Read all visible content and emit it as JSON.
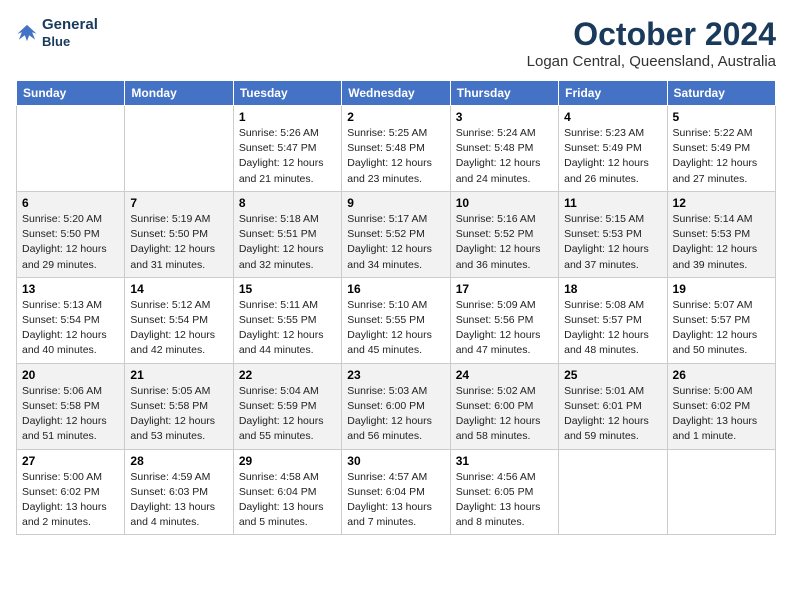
{
  "logo": {
    "line1": "General",
    "line2": "Blue"
  },
  "title": "October 2024",
  "location": "Logan Central, Queensland, Australia",
  "headers": [
    "Sunday",
    "Monday",
    "Tuesday",
    "Wednesday",
    "Thursday",
    "Friday",
    "Saturday"
  ],
  "weeks": [
    [
      {
        "day": "",
        "info": ""
      },
      {
        "day": "",
        "info": ""
      },
      {
        "day": "1",
        "info": "Sunrise: 5:26 AM\nSunset: 5:47 PM\nDaylight: 12 hours\nand 21 minutes."
      },
      {
        "day": "2",
        "info": "Sunrise: 5:25 AM\nSunset: 5:48 PM\nDaylight: 12 hours\nand 23 minutes."
      },
      {
        "day": "3",
        "info": "Sunrise: 5:24 AM\nSunset: 5:48 PM\nDaylight: 12 hours\nand 24 minutes."
      },
      {
        "day": "4",
        "info": "Sunrise: 5:23 AM\nSunset: 5:49 PM\nDaylight: 12 hours\nand 26 minutes."
      },
      {
        "day": "5",
        "info": "Sunrise: 5:22 AM\nSunset: 5:49 PM\nDaylight: 12 hours\nand 27 minutes."
      }
    ],
    [
      {
        "day": "6",
        "info": "Sunrise: 5:20 AM\nSunset: 5:50 PM\nDaylight: 12 hours\nand 29 minutes."
      },
      {
        "day": "7",
        "info": "Sunrise: 5:19 AM\nSunset: 5:50 PM\nDaylight: 12 hours\nand 31 minutes."
      },
      {
        "day": "8",
        "info": "Sunrise: 5:18 AM\nSunset: 5:51 PM\nDaylight: 12 hours\nand 32 minutes."
      },
      {
        "day": "9",
        "info": "Sunrise: 5:17 AM\nSunset: 5:52 PM\nDaylight: 12 hours\nand 34 minutes."
      },
      {
        "day": "10",
        "info": "Sunrise: 5:16 AM\nSunset: 5:52 PM\nDaylight: 12 hours\nand 36 minutes."
      },
      {
        "day": "11",
        "info": "Sunrise: 5:15 AM\nSunset: 5:53 PM\nDaylight: 12 hours\nand 37 minutes."
      },
      {
        "day": "12",
        "info": "Sunrise: 5:14 AM\nSunset: 5:53 PM\nDaylight: 12 hours\nand 39 minutes."
      }
    ],
    [
      {
        "day": "13",
        "info": "Sunrise: 5:13 AM\nSunset: 5:54 PM\nDaylight: 12 hours\nand 40 minutes."
      },
      {
        "day": "14",
        "info": "Sunrise: 5:12 AM\nSunset: 5:54 PM\nDaylight: 12 hours\nand 42 minutes."
      },
      {
        "day": "15",
        "info": "Sunrise: 5:11 AM\nSunset: 5:55 PM\nDaylight: 12 hours\nand 44 minutes."
      },
      {
        "day": "16",
        "info": "Sunrise: 5:10 AM\nSunset: 5:55 PM\nDaylight: 12 hours\nand 45 minutes."
      },
      {
        "day": "17",
        "info": "Sunrise: 5:09 AM\nSunset: 5:56 PM\nDaylight: 12 hours\nand 47 minutes."
      },
      {
        "day": "18",
        "info": "Sunrise: 5:08 AM\nSunset: 5:57 PM\nDaylight: 12 hours\nand 48 minutes."
      },
      {
        "day": "19",
        "info": "Sunrise: 5:07 AM\nSunset: 5:57 PM\nDaylight: 12 hours\nand 50 minutes."
      }
    ],
    [
      {
        "day": "20",
        "info": "Sunrise: 5:06 AM\nSunset: 5:58 PM\nDaylight: 12 hours\nand 51 minutes."
      },
      {
        "day": "21",
        "info": "Sunrise: 5:05 AM\nSunset: 5:58 PM\nDaylight: 12 hours\nand 53 minutes."
      },
      {
        "day": "22",
        "info": "Sunrise: 5:04 AM\nSunset: 5:59 PM\nDaylight: 12 hours\nand 55 minutes."
      },
      {
        "day": "23",
        "info": "Sunrise: 5:03 AM\nSunset: 6:00 PM\nDaylight: 12 hours\nand 56 minutes."
      },
      {
        "day": "24",
        "info": "Sunrise: 5:02 AM\nSunset: 6:00 PM\nDaylight: 12 hours\nand 58 minutes."
      },
      {
        "day": "25",
        "info": "Sunrise: 5:01 AM\nSunset: 6:01 PM\nDaylight: 12 hours\nand 59 minutes."
      },
      {
        "day": "26",
        "info": "Sunrise: 5:00 AM\nSunset: 6:02 PM\nDaylight: 13 hours\nand 1 minute."
      }
    ],
    [
      {
        "day": "27",
        "info": "Sunrise: 5:00 AM\nSunset: 6:02 PM\nDaylight: 13 hours\nand 2 minutes."
      },
      {
        "day": "28",
        "info": "Sunrise: 4:59 AM\nSunset: 6:03 PM\nDaylight: 13 hours\nand 4 minutes."
      },
      {
        "day": "29",
        "info": "Sunrise: 4:58 AM\nSunset: 6:04 PM\nDaylight: 13 hours\nand 5 minutes."
      },
      {
        "day": "30",
        "info": "Sunrise: 4:57 AM\nSunset: 6:04 PM\nDaylight: 13 hours\nand 7 minutes."
      },
      {
        "day": "31",
        "info": "Sunrise: 4:56 AM\nSunset: 6:05 PM\nDaylight: 13 hours\nand 8 minutes."
      },
      {
        "day": "",
        "info": ""
      },
      {
        "day": "",
        "info": ""
      }
    ]
  ]
}
